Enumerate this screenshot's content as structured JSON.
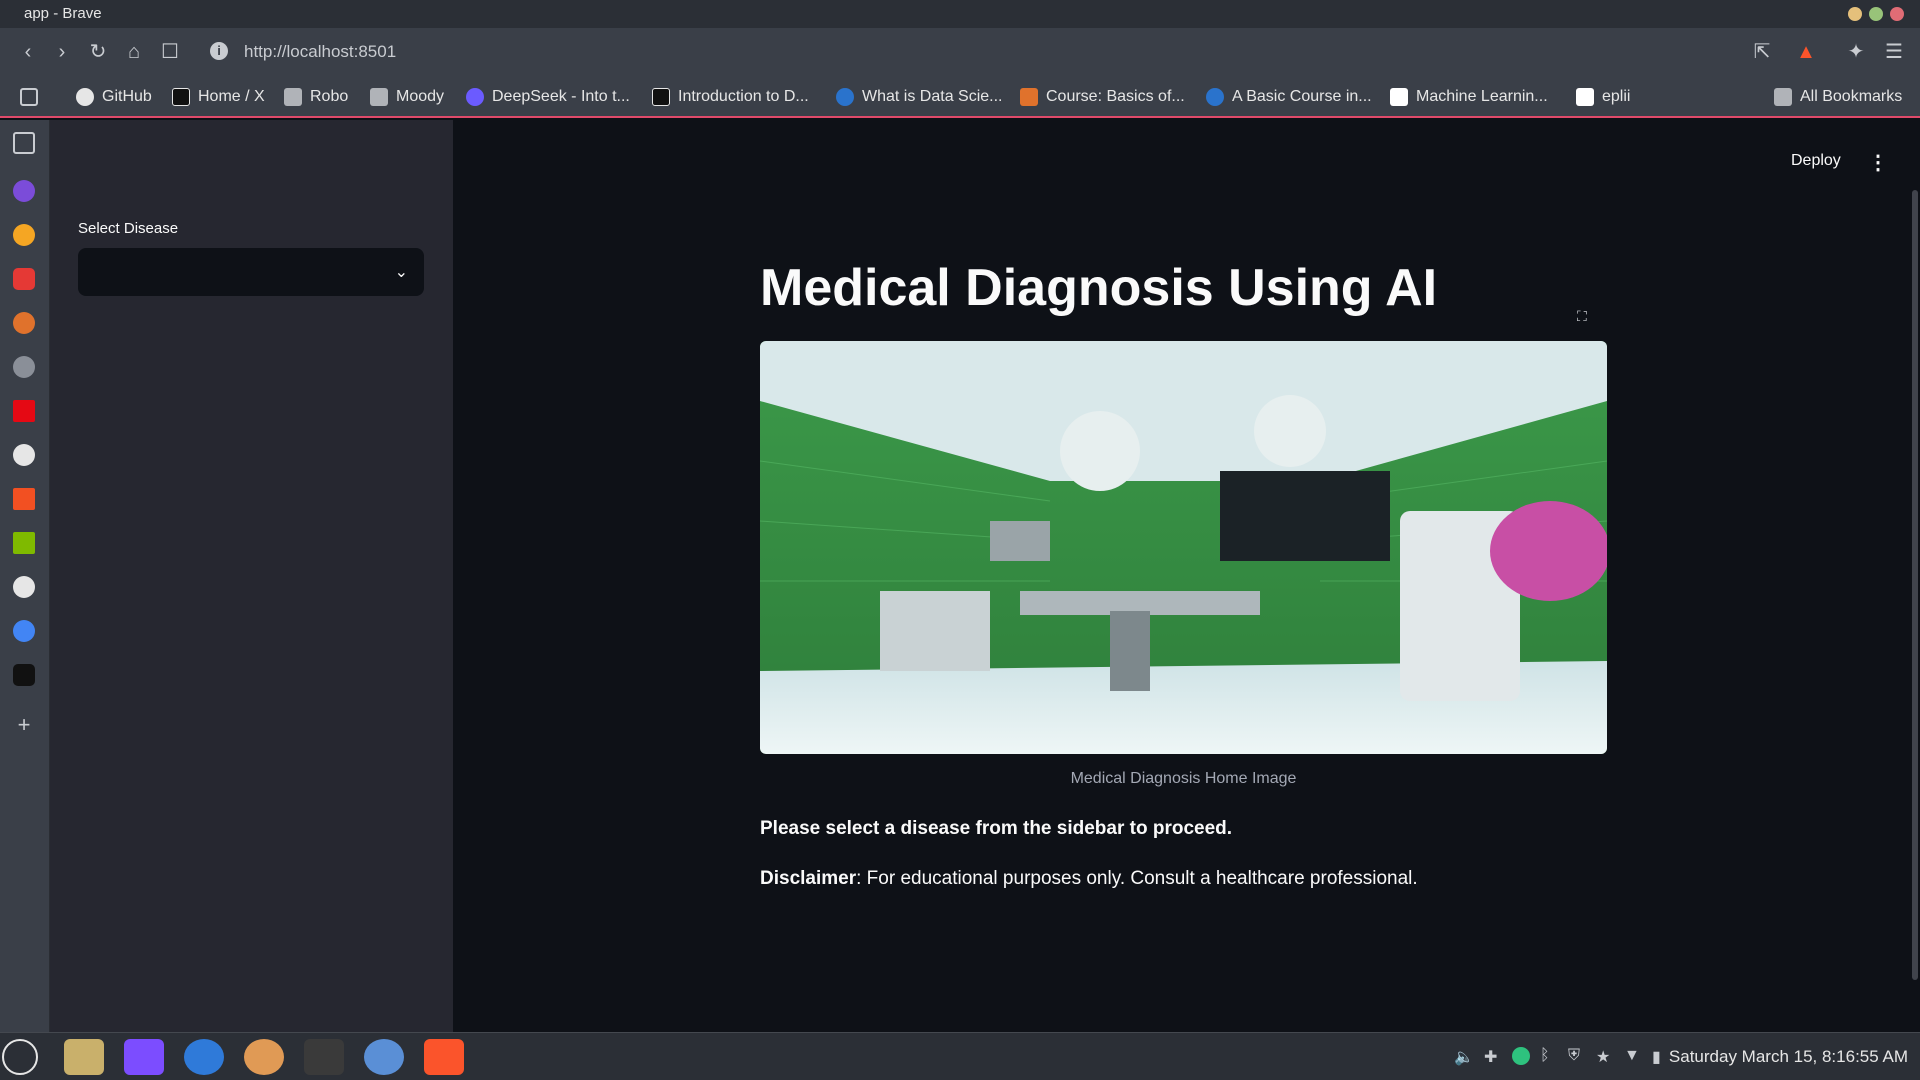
{
  "window": {
    "title": "app - Brave"
  },
  "toolbar": {
    "url": "http://localhost:8501"
  },
  "bookmarks": [
    {
      "label": "GitHub",
      "icon": "github-icon"
    },
    {
      "label": "Home / X",
      "icon": "x-icon"
    },
    {
      "label": "Robo",
      "icon": "folder-icon"
    },
    {
      "label": "Moody",
      "icon": "folder-icon"
    },
    {
      "label": "DeepSeek - Into t...",
      "icon": "deepseek-icon"
    },
    {
      "label": "Introduction to D...",
      "icon": "site-icon"
    },
    {
      "label": "What is Data Scie...",
      "icon": "coursera-icon"
    },
    {
      "label": "Course: Basics of...",
      "icon": "site-icon"
    },
    {
      "label": "A Basic Course in...",
      "icon": "site-icon"
    },
    {
      "label": "Machine Learnin...",
      "icon": "chart-icon"
    },
    {
      "label": "eplii",
      "icon": "site-icon"
    },
    {
      "label": "All Bookmarks",
      "icon": "folder-icon"
    }
  ],
  "sidebar": {
    "select_label": "Select Disease",
    "select_value": ""
  },
  "header": {
    "deploy_label": "Deploy"
  },
  "main": {
    "title": "Medical Diagnosis Using AI",
    "image_caption": "Medical Diagnosis Home Image",
    "prompt": "Please select a disease from the sidebar to proceed.",
    "disclaimer_label": "Disclaimer",
    "disclaimer_text": ": For educational purposes only. Consult a healthcare professional."
  },
  "taskbar": {
    "clock": "Saturday March 15, 8:16:55 AM"
  },
  "colors": {
    "accent": "#e04a6a",
    "background": "#0e1117",
    "sidebar": "#262730"
  }
}
